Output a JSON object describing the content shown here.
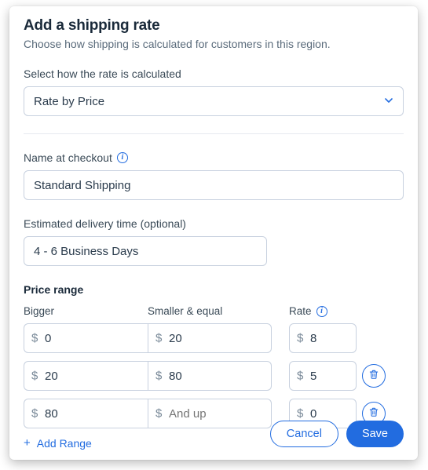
{
  "header": {
    "title": "Add a shipping rate",
    "subtitle": "Choose how shipping is calculated for customers in this region."
  },
  "calc": {
    "label": "Select how the rate is calculated",
    "value": "Rate by Price"
  },
  "name_at_checkout": {
    "label": "Name at checkout",
    "value": "Standard Shipping"
  },
  "delivery": {
    "label": "Estimated delivery time (optional)",
    "value": "4 - 6 Business Days"
  },
  "range": {
    "title": "Price range",
    "cols": {
      "bigger": "Bigger",
      "smaller": "Smaller & equal",
      "rate": "Rate"
    },
    "currency": "$",
    "and_up_placeholder": "And up",
    "rows": [
      {
        "bigger": "0",
        "smaller": "20",
        "rate": "8",
        "deletable": false
      },
      {
        "bigger": "20",
        "smaller": "80",
        "rate": "5",
        "deletable": true
      },
      {
        "bigger": "80",
        "smaller": "",
        "rate": "0",
        "deletable": true
      }
    ],
    "add_label": "Add Range"
  },
  "footer": {
    "cancel": "Cancel",
    "save": "Save"
  }
}
